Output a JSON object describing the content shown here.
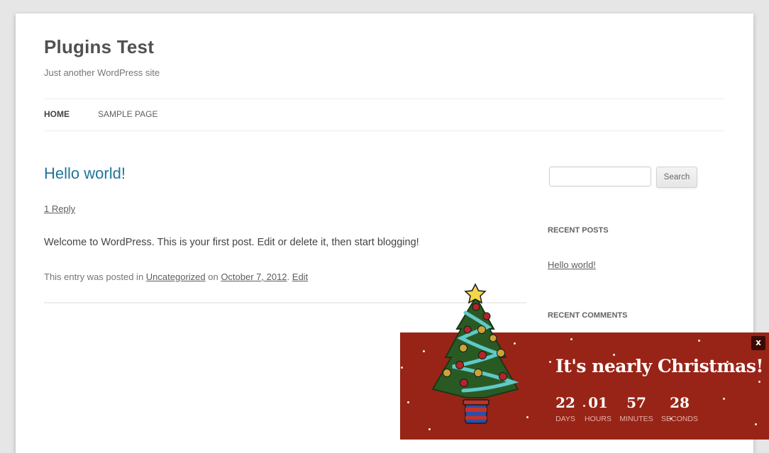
{
  "site": {
    "title": "Plugins Test",
    "description": "Just another WordPress site"
  },
  "nav": {
    "items": [
      "HOME",
      "SAMPLE PAGE"
    ]
  },
  "post": {
    "title": "Hello world!",
    "reply_link": "1 Reply",
    "content": "Welcome to WordPress. This is your first post. Edit or delete it, then start blogging!",
    "meta_prefix": "This entry was posted in ",
    "category": "Uncategorized",
    "meta_on": " on ",
    "date": "October 7, 2012",
    "meta_sep": ". ",
    "edit": "Edit"
  },
  "sidebar": {
    "search_button": "Search",
    "search_value": "",
    "recent_posts_title": "RECENT POSTS",
    "recent_posts": [
      "Hello world!"
    ],
    "recent_comments_title": "RECENT COMMENTS"
  },
  "popup": {
    "title": "It's nearly Christmas!",
    "close_label": "x",
    "countdown": [
      {
        "value": "22",
        "label": "DAYS"
      },
      {
        "value": "01",
        "label": "HOURS"
      },
      {
        "value": "57",
        "label": "MINUTES"
      },
      {
        "value": "28",
        "label": "SECONDS"
      }
    ],
    "background_color": "#982417",
    "tree_icon": "christmas-tree-icon"
  }
}
